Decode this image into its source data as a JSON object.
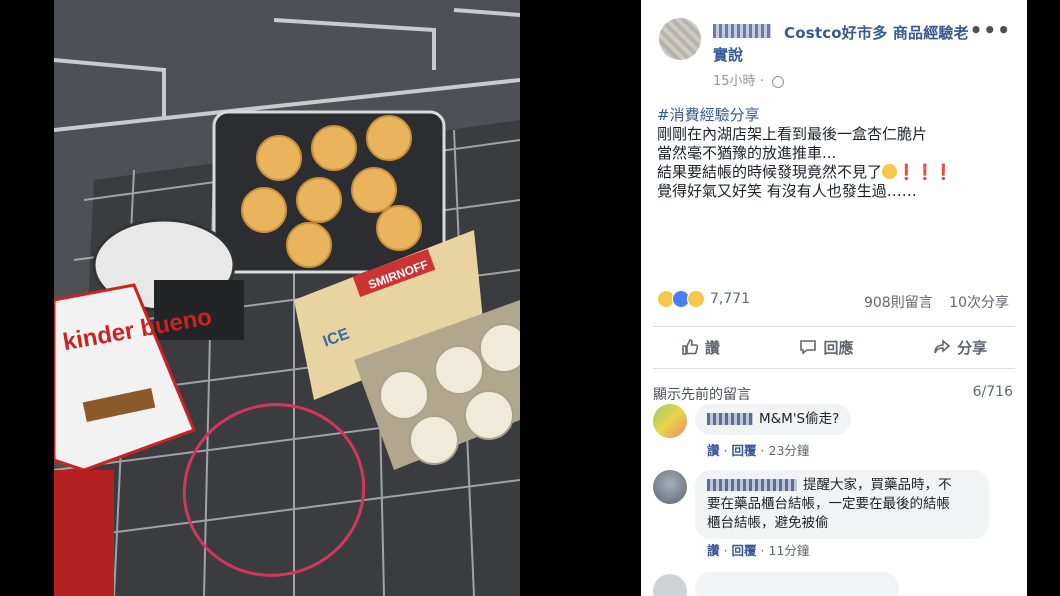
{
  "post": {
    "group_name": "Costco好市多 商品經驗老",
    "group_name_cont": "實說",
    "time": "15小時",
    "more_icon": "more-dots-icon",
    "text_lines": [
      "#消費經驗分享",
      "剛剛在內湖店架上看到最後一盒杏仁脆片",
      "當然毫不猶豫的放進推車...",
      "結果要結帳的時候發現竟然不見了",
      "覺得好氣又好笑 有沒有人也發生過……"
    ],
    "text_line4_suffix": "❗❗❗",
    "reaction_count": "7,771",
    "comments_count": "908則留言",
    "shares_count": "10次分享"
  },
  "actions": {
    "like": "讚",
    "comment": "回應",
    "share": "分享"
  },
  "comments_header": {
    "label": "顯示先前的留言",
    "count": "6/716"
  },
  "comments": [
    {
      "text": "M&M'S偷走?",
      "like": "讚",
      "reply": "回覆",
      "time": "23分鐘"
    },
    {
      "text_line1": "提醒大家，買藥品時，不",
      "text_line2": "要在藥品櫃台結帳，一定要在最後的結帳",
      "text_line3": "櫃台結帳，避免被偷",
      "like": "讚",
      "reply": "回覆",
      "time": "11分鐘"
    }
  ],
  "photo": {
    "product_brand": "kinder bueno",
    "box_label": "SMIRNOFF",
    "box_label2": "ICE"
  },
  "colors": {
    "link": "#385898",
    "text": "#1d2129",
    "muted": "#606770",
    "alert": "#e0283a"
  }
}
